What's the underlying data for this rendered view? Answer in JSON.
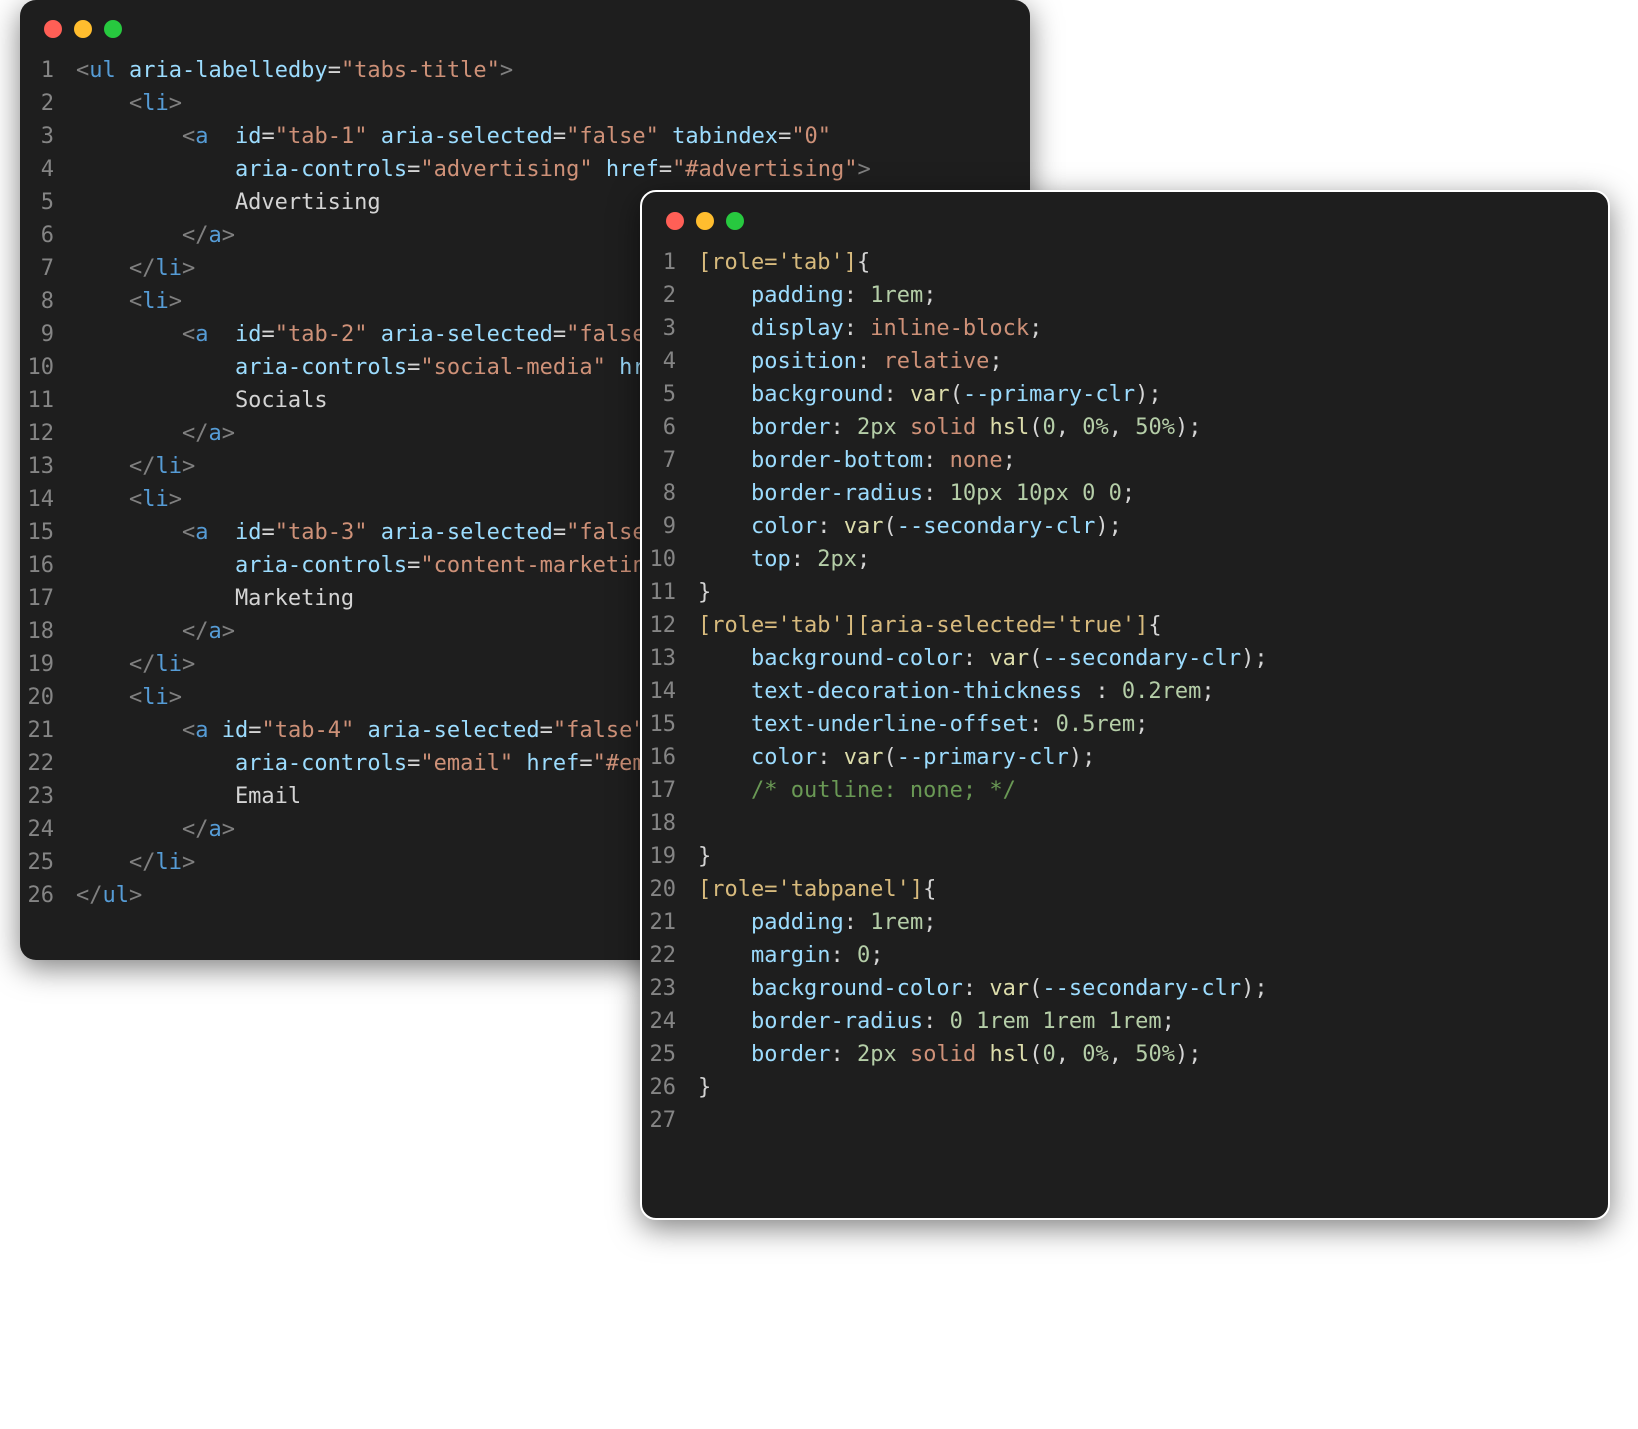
{
  "colors": {
    "window_bg": "#1e1e1e",
    "red": "#ff5f56",
    "yellow": "#ffbd2e",
    "green": "#27c93f",
    "gutter": "#858585",
    "text": "#d4d4d4",
    "punct": "#808080",
    "tag": "#569cd6",
    "attr": "#9cdcfe",
    "string": "#ce9178",
    "selector": "#d7ba7d",
    "number": "#b5cea8",
    "func": "#dcdcaa",
    "comment": "#6a9955"
  },
  "back_window": {
    "lines": [
      [
        [
          "p",
          "<"
        ],
        [
          "tag",
          "ul"
        ],
        [
          "txt",
          " "
        ],
        [
          "attr",
          "aria-labelledby"
        ],
        [
          "op",
          "="
        ],
        [
          "str",
          "\"tabs-title\""
        ],
        [
          "p",
          ">"
        ]
      ],
      [
        [
          "txt",
          "    "
        ],
        [
          "p",
          "<"
        ],
        [
          "tag",
          "li"
        ],
        [
          "p",
          ">"
        ]
      ],
      [
        [
          "txt",
          "        "
        ],
        [
          "p",
          "<"
        ],
        [
          "tag",
          "a"
        ],
        [
          "txt",
          "  "
        ],
        [
          "attr",
          "id"
        ],
        [
          "op",
          "="
        ],
        [
          "str",
          "\"tab-1\""
        ],
        [
          "txt",
          " "
        ],
        [
          "attr",
          "aria-selected"
        ],
        [
          "op",
          "="
        ],
        [
          "str",
          "\"false\""
        ],
        [
          "txt",
          " "
        ],
        [
          "attr",
          "tabindex"
        ],
        [
          "op",
          "="
        ],
        [
          "str",
          "\"0\""
        ]
      ],
      [
        [
          "txt",
          "            "
        ],
        [
          "attr",
          "aria-controls"
        ],
        [
          "op",
          "="
        ],
        [
          "str",
          "\"advertising\""
        ],
        [
          "txt",
          " "
        ],
        [
          "attr",
          "href"
        ],
        [
          "op",
          "="
        ],
        [
          "str",
          "\"#advertising\""
        ],
        [
          "p",
          ">"
        ]
      ],
      [
        [
          "txt",
          "            Advertising"
        ]
      ],
      [
        [
          "txt",
          "        "
        ],
        [
          "p",
          "</"
        ],
        [
          "tag",
          "a"
        ],
        [
          "p",
          ">"
        ]
      ],
      [
        [
          "txt",
          "    "
        ],
        [
          "p",
          "</"
        ],
        [
          "tag",
          "li"
        ],
        [
          "p",
          ">"
        ]
      ],
      [
        [
          "txt",
          "    "
        ],
        [
          "p",
          "<"
        ],
        [
          "tag",
          "li"
        ],
        [
          "p",
          ">"
        ]
      ],
      [
        [
          "txt",
          "        "
        ],
        [
          "p",
          "<"
        ],
        [
          "tag",
          "a"
        ],
        [
          "txt",
          "  "
        ],
        [
          "attr",
          "id"
        ],
        [
          "op",
          "="
        ],
        [
          "str",
          "\"tab-2\""
        ],
        [
          "txt",
          " "
        ],
        [
          "attr",
          "aria-selected"
        ],
        [
          "op",
          "="
        ],
        [
          "str",
          "\"false\""
        ]
      ],
      [
        [
          "txt",
          "            "
        ],
        [
          "attr",
          "aria-controls"
        ],
        [
          "op",
          "="
        ],
        [
          "str",
          "\"social-media\""
        ],
        [
          "txt",
          " "
        ],
        [
          "attr",
          "hre"
        ]
      ],
      [
        [
          "txt",
          "            Socials"
        ]
      ],
      [
        [
          "txt",
          "        "
        ],
        [
          "p",
          "</"
        ],
        [
          "tag",
          "a"
        ],
        [
          "p",
          ">"
        ]
      ],
      [
        [
          "txt",
          "    "
        ],
        [
          "p",
          "</"
        ],
        [
          "tag",
          "li"
        ],
        [
          "p",
          ">"
        ]
      ],
      [
        [
          "txt",
          "    "
        ],
        [
          "p",
          "<"
        ],
        [
          "tag",
          "li"
        ],
        [
          "p",
          ">"
        ]
      ],
      [
        [
          "txt",
          "        "
        ],
        [
          "p",
          "<"
        ],
        [
          "tag",
          "a"
        ],
        [
          "txt",
          "  "
        ],
        [
          "attr",
          "id"
        ],
        [
          "op",
          "="
        ],
        [
          "str",
          "\"tab-3\""
        ],
        [
          "txt",
          " "
        ],
        [
          "attr",
          "aria-selected"
        ],
        [
          "op",
          "="
        ],
        [
          "str",
          "\"false\""
        ]
      ],
      [
        [
          "txt",
          "            "
        ],
        [
          "attr",
          "aria-controls"
        ],
        [
          "op",
          "="
        ],
        [
          "str",
          "\"content-marketing"
        ]
      ],
      [
        [
          "txt",
          "            Marketing"
        ]
      ],
      [
        [
          "txt",
          "        "
        ],
        [
          "p",
          "</"
        ],
        [
          "tag",
          "a"
        ],
        [
          "p",
          ">"
        ]
      ],
      [
        [
          "txt",
          "    "
        ],
        [
          "p",
          "</"
        ],
        [
          "tag",
          "li"
        ],
        [
          "p",
          ">"
        ]
      ],
      [
        [
          "txt",
          "    "
        ],
        [
          "p",
          "<"
        ],
        [
          "tag",
          "li"
        ],
        [
          "p",
          ">"
        ]
      ],
      [
        [
          "txt",
          "        "
        ],
        [
          "p",
          "<"
        ],
        [
          "tag",
          "a"
        ],
        [
          "txt",
          " "
        ],
        [
          "attr",
          "id"
        ],
        [
          "op",
          "="
        ],
        [
          "str",
          "\"tab-4\""
        ],
        [
          "txt",
          " "
        ],
        [
          "attr",
          "aria-selected"
        ],
        [
          "op",
          "="
        ],
        [
          "str",
          "\"false\""
        ]
      ],
      [
        [
          "txt",
          "            "
        ],
        [
          "attr",
          "aria-controls"
        ],
        [
          "op",
          "="
        ],
        [
          "str",
          "\"email\""
        ],
        [
          "txt",
          " "
        ],
        [
          "attr",
          "href"
        ],
        [
          "op",
          "="
        ],
        [
          "str",
          "\"#ema"
        ]
      ],
      [
        [
          "txt",
          "            Email"
        ]
      ],
      [
        [
          "txt",
          "        "
        ],
        [
          "p",
          "</"
        ],
        [
          "tag",
          "a"
        ],
        [
          "p",
          ">"
        ]
      ],
      [
        [
          "txt",
          "    "
        ],
        [
          "p",
          "</"
        ],
        [
          "tag",
          "li"
        ],
        [
          "p",
          ">"
        ]
      ],
      [
        [
          "p",
          "</"
        ],
        [
          "tag",
          "ul"
        ],
        [
          "p",
          ">"
        ]
      ]
    ]
  },
  "front_window": {
    "lines": [
      [
        [
          "sel",
          "[role='tab']"
        ],
        [
          "txt",
          "{"
        ]
      ],
      [
        [
          "txt",
          "    "
        ],
        [
          "attr",
          "padding"
        ],
        [
          "op",
          ": "
        ],
        [
          "num",
          "1rem"
        ],
        [
          "op",
          ";"
        ]
      ],
      [
        [
          "txt",
          "    "
        ],
        [
          "attr",
          "display"
        ],
        [
          "op",
          ": "
        ],
        [
          "kw",
          "inline-block"
        ],
        [
          "op",
          ";"
        ]
      ],
      [
        [
          "txt",
          "    "
        ],
        [
          "attr",
          "position"
        ],
        [
          "op",
          ": "
        ],
        [
          "kw",
          "relative"
        ],
        [
          "op",
          ";"
        ]
      ],
      [
        [
          "txt",
          "    "
        ],
        [
          "attr",
          "background"
        ],
        [
          "op",
          ": "
        ],
        [
          "fn",
          "var"
        ],
        [
          "txt",
          "("
        ],
        [
          "attr",
          "--primary-clr"
        ],
        [
          "txt",
          ")"
        ],
        [
          "op",
          ";"
        ]
      ],
      [
        [
          "txt",
          "    "
        ],
        [
          "attr",
          "border"
        ],
        [
          "op",
          ": "
        ],
        [
          "num",
          "2px"
        ],
        [
          "txt",
          " "
        ],
        [
          "kw",
          "solid"
        ],
        [
          "txt",
          " "
        ],
        [
          "fn",
          "hsl"
        ],
        [
          "txt",
          "("
        ],
        [
          "num",
          "0"
        ],
        [
          "txt",
          ", "
        ],
        [
          "num",
          "0%"
        ],
        [
          "txt",
          ", "
        ],
        [
          "num",
          "50%"
        ],
        [
          "txt",
          ")"
        ],
        [
          "op",
          ";"
        ]
      ],
      [
        [
          "txt",
          "    "
        ],
        [
          "attr",
          "border-bottom"
        ],
        [
          "op",
          ": "
        ],
        [
          "kw",
          "none"
        ],
        [
          "op",
          ";"
        ]
      ],
      [
        [
          "txt",
          "    "
        ],
        [
          "attr",
          "border-radius"
        ],
        [
          "op",
          ": "
        ],
        [
          "num",
          "10px"
        ],
        [
          "txt",
          " "
        ],
        [
          "num",
          "10px"
        ],
        [
          "txt",
          " "
        ],
        [
          "num",
          "0"
        ],
        [
          "txt",
          " "
        ],
        [
          "num",
          "0"
        ],
        [
          "op",
          ";"
        ]
      ],
      [
        [
          "txt",
          "    "
        ],
        [
          "attr",
          "color"
        ],
        [
          "op",
          ": "
        ],
        [
          "fn",
          "var"
        ],
        [
          "txt",
          "("
        ],
        [
          "attr",
          "--secondary-clr"
        ],
        [
          "txt",
          ")"
        ],
        [
          "op",
          ";"
        ]
      ],
      [
        [
          "txt",
          "    "
        ],
        [
          "attr",
          "top"
        ],
        [
          "op",
          ": "
        ],
        [
          "num",
          "2px"
        ],
        [
          "op",
          ";"
        ]
      ],
      [
        [
          "txt",
          "}"
        ]
      ],
      [
        [
          "sel",
          "[role='tab'][aria-selected='true']"
        ],
        [
          "txt",
          "{"
        ]
      ],
      [
        [
          "txt",
          "    "
        ],
        [
          "attr",
          "background-color"
        ],
        [
          "op",
          ": "
        ],
        [
          "fn",
          "var"
        ],
        [
          "txt",
          "("
        ],
        [
          "attr",
          "--secondary-clr"
        ],
        [
          "txt",
          ")"
        ],
        [
          "op",
          ";"
        ]
      ],
      [
        [
          "txt",
          "    "
        ],
        [
          "attr",
          "text-decoration-thickness"
        ],
        [
          "op",
          " : "
        ],
        [
          "num",
          "0.2rem"
        ],
        [
          "op",
          ";"
        ]
      ],
      [
        [
          "txt",
          "    "
        ],
        [
          "attr",
          "text-underline-offset"
        ],
        [
          "op",
          ": "
        ],
        [
          "num",
          "0.5rem"
        ],
        [
          "op",
          ";"
        ]
      ],
      [
        [
          "txt",
          "    "
        ],
        [
          "attr",
          "color"
        ],
        [
          "op",
          ": "
        ],
        [
          "fn",
          "var"
        ],
        [
          "txt",
          "("
        ],
        [
          "attr",
          "--primary-clr"
        ],
        [
          "txt",
          ")"
        ],
        [
          "op",
          ";"
        ]
      ],
      [
        [
          "txt",
          "    "
        ],
        [
          "cmt",
          "/* outline: none; */"
        ]
      ],
      [
        [
          "txt",
          ""
        ]
      ],
      [
        [
          "txt",
          "}"
        ]
      ],
      [
        [
          "sel",
          "[role='tabpanel']"
        ],
        [
          "txt",
          "{"
        ]
      ],
      [
        [
          "txt",
          "    "
        ],
        [
          "attr",
          "padding"
        ],
        [
          "op",
          ": "
        ],
        [
          "num",
          "1rem"
        ],
        [
          "op",
          ";"
        ]
      ],
      [
        [
          "txt",
          "    "
        ],
        [
          "attr",
          "margin"
        ],
        [
          "op",
          ": "
        ],
        [
          "num",
          "0"
        ],
        [
          "op",
          ";"
        ]
      ],
      [
        [
          "txt",
          "    "
        ],
        [
          "attr",
          "background-color"
        ],
        [
          "op",
          ": "
        ],
        [
          "fn",
          "var"
        ],
        [
          "txt",
          "("
        ],
        [
          "attr",
          "--secondary-clr"
        ],
        [
          "txt",
          ")"
        ],
        [
          "op",
          ";"
        ]
      ],
      [
        [
          "txt",
          "    "
        ],
        [
          "attr",
          "border-radius"
        ],
        [
          "op",
          ": "
        ],
        [
          "num",
          "0"
        ],
        [
          "txt",
          " "
        ],
        [
          "num",
          "1rem"
        ],
        [
          "txt",
          " "
        ],
        [
          "num",
          "1rem"
        ],
        [
          "txt",
          " "
        ],
        [
          "num",
          "1rem"
        ],
        [
          "op",
          ";"
        ]
      ],
      [
        [
          "txt",
          "    "
        ],
        [
          "attr",
          "border"
        ],
        [
          "op",
          ": "
        ],
        [
          "num",
          "2px"
        ],
        [
          "txt",
          " "
        ],
        [
          "kw",
          "solid"
        ],
        [
          "txt",
          " "
        ],
        [
          "fn",
          "hsl"
        ],
        [
          "txt",
          "("
        ],
        [
          "num",
          "0"
        ],
        [
          "txt",
          ", "
        ],
        [
          "num",
          "0%"
        ],
        [
          "txt",
          ", "
        ],
        [
          "num",
          "50%"
        ],
        [
          "txt",
          ")"
        ],
        [
          "op",
          ";"
        ]
      ],
      [
        [
          "txt",
          "}"
        ]
      ],
      [
        [
          "txt",
          ""
        ]
      ]
    ]
  }
}
